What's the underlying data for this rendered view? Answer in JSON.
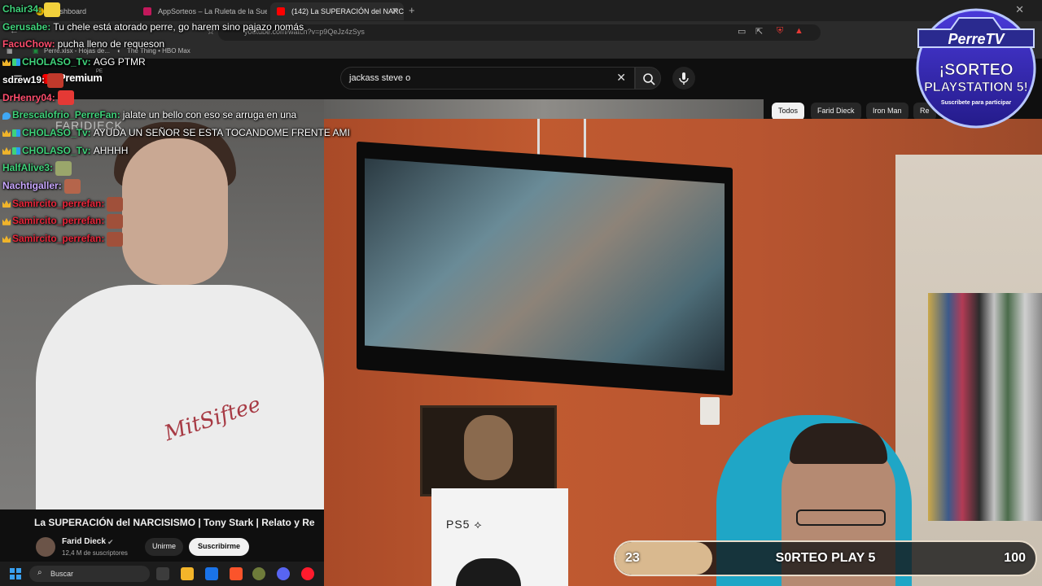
{
  "browser": {
    "tabs": [
      {
        "label": "Dashboard",
        "favicon_color": "#f2c200"
      },
      {
        "label": "AppSorteos – La Ruleta de la Suerte",
        "favicon_color": "#c2185b"
      },
      {
        "label": "(142) La SUPERACIÓN del NARC",
        "favicon_color": "#ff0000"
      }
    ],
    "new_tab": "+",
    "close": "✕",
    "url": "youtube.com/watch?v=p9QeJz4zSys",
    "bookmarks": [
      "Perre.xlsx - Hojas de...",
      "The Thing • HBO Max"
    ]
  },
  "youtube": {
    "logo_text": "Premium",
    "logo_sup": "PE",
    "search_value": "jackass steve o",
    "chips": [
      "Todos",
      "Farid Dieck",
      "Iron Man",
      "Re"
    ],
    "video_watermark": "FARIDIECK",
    "shirt_print": "MitSiftee",
    "video_title": "La SUPERACIÓN del NARCISISMO | Tony Stark | Relato y Re",
    "channel_name": "Farid Dieck",
    "subscriber_count": "12,4 M de suscriptores",
    "join_label": "Unirme",
    "subscribe_label": "Suscribirme"
  },
  "taskbar": {
    "search_placeholder": "Buscar"
  },
  "chat": [
    {
      "badges": [],
      "user": "Chair34:",
      "color": "#3fd27a",
      "text": "",
      "emote": "#f2d13c"
    },
    {
      "badges": [],
      "user": "Gerusabe:",
      "color": "#3fd27a",
      "text": "Tu chele está atorado perre, go harem sino pajazo nomás"
    },
    {
      "badges": [],
      "user": "FacuChow:",
      "color": "#ff4d6d",
      "text": "pucha lleno de requeson"
    },
    {
      "badges": [
        "crown",
        "grid"
      ],
      "user": "CHOLASO_Tv:",
      "color": "#3fd27a",
      "text": "AGG PTMR"
    },
    {
      "badges": [],
      "user": "sdrew19:",
      "color": "#ffffff",
      "text": "",
      "emote": "#c0392b"
    },
    {
      "badges": [],
      "user": "DrHenry04:",
      "color": "#ff4d6d",
      "text": "",
      "emote": "#e53935"
    },
    {
      "badges": [
        "drop"
      ],
      "user": "Brescalofrio_PerreFan:",
      "color": "#3fd27a",
      "text": "jalate un bello con eso se arruga en una"
    },
    {
      "badges": [
        "crown",
        "grid"
      ],
      "user": "CHOLASO_Tv:",
      "color": "#3fd27a",
      "text": "AYUDA UN SEÑOR SE ESTA TOCANDOME FRENTE AMI"
    },
    {
      "badges": [
        "crown",
        "grid"
      ],
      "user": "CHOLASO_Tv:",
      "color": "#3fd27a",
      "text": "AHHHH"
    },
    {
      "badges": [],
      "user": "HalfAlive3:",
      "color": "#3fd27a",
      "text": "",
      "emote": "#9aa66b"
    },
    {
      "badges": [],
      "user": "Nachtigaller:",
      "color": "#c9a7ff",
      "text": "",
      "emote": "#b5654b"
    },
    {
      "badges": [
        "crown"
      ],
      "user": "Samircito_perrefan:",
      "color": "#e8253a",
      "text": "",
      "emote": "#a0503a"
    },
    {
      "badges": [
        "crown"
      ],
      "user": "Samircito_perrefan:",
      "color": "#e8253a",
      "text": "",
      "emote": "#a0503a"
    },
    {
      "badges": [
        "crown"
      ],
      "user": "Samircito_perrefan:",
      "color": "#e8253a",
      "text": "",
      "emote": "#a0503a"
    }
  ],
  "sorteo": {
    "brand": "PerreTV",
    "title_line1": "¡SORTEO",
    "title_line2": "PLAYSTATION 5!",
    "subtitle": "Suscribete para participar"
  },
  "ps5_box_logo": "PS5 ⟡",
  "goal": {
    "current": 23,
    "max": 100,
    "label": "S0RTEO PLAY 5"
  },
  "colors": {
    "youtube_red": "#ff0000",
    "goal_fill": "#d9b98f",
    "hood": "#1fa6c6"
  }
}
